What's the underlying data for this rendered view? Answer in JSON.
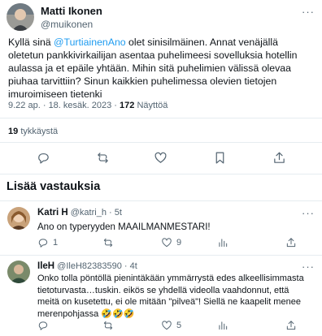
{
  "main_tweet": {
    "author_name": "Matti Ikonen",
    "author_handle": "@muikonen",
    "text_part1": "Kyllä sinä ",
    "mention": "@TurtiainenAno",
    "text_part2": " olet sinisilmäinen. Annat venäjällä oletetun pankkivirkailijan asentaa puhelimeesi sovelluksia hotellin aulassa ja et epäile yhtään. Mihin sitä puhelimien välissä olevaa piuhaa tarvittiin? Sinun kaikkien puhelimessa olevien tietojen imuroimiseen tietenki",
    "time": "9.22 ap.",
    "separator": "·",
    "date": "18. kesäk. 2023",
    "views_count": "172",
    "views_label": "Näyttöä",
    "likes_count": "19",
    "likes_label": "tykkäystä"
  },
  "more_replies": {
    "heading": "Lisää vastauksia"
  },
  "replies": [
    {
      "author_name": "Katri H",
      "author_handle": "@katri_h",
      "separator": "·",
      "time": "5t",
      "text": "Ano on typeryyden MAAILMANMESTARI!",
      "reply_count": "1",
      "retweet_count": "",
      "like_count": "9",
      "view_count": "",
      "text_dots": "···"
    },
    {
      "author_name": "IleH",
      "author_handle": "@IleH82383590",
      "separator": "·",
      "time": "4t",
      "text": "Onko tolla pöntöllä pienintäkään ymmärrystä edes alkeellisimmasta tietoturvasta…tuskin. eikös se yhdellä videolla vaahdonnut, että meitä on kusetettu, ei ole mitään \"pilveä\"! Siellä ne kaapelit menee merenpohjassa 🤣🤣🤣",
      "reply_count": "",
      "retweet_count": "",
      "like_count": "5",
      "view_count": "",
      "text_dots": "···"
    }
  ],
  "more_dots": "···",
  "colors": {
    "link": "#1d9bf0",
    "muted": "#536471",
    "divider": "#e6ecf0"
  }
}
